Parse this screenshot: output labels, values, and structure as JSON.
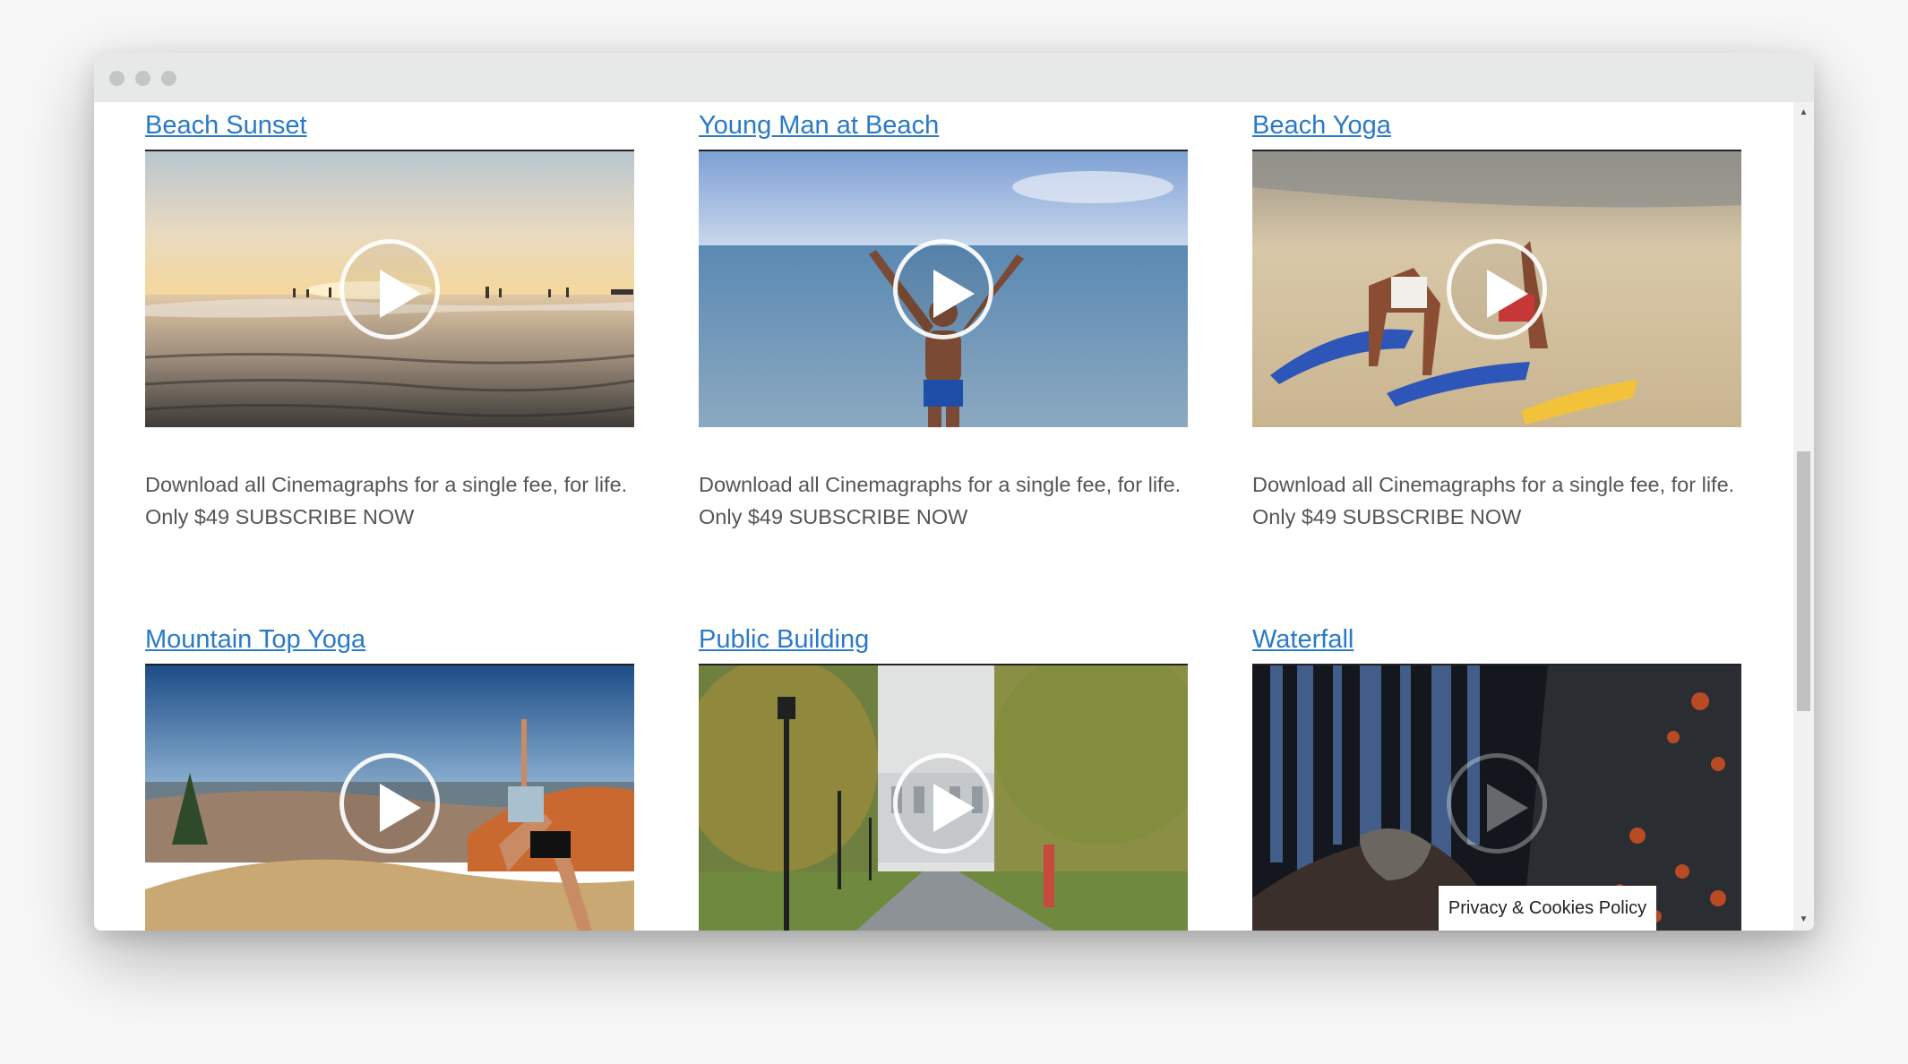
{
  "window": {
    "controls": [
      "close",
      "minimize",
      "maximize"
    ]
  },
  "cards": [
    {
      "title": "Beach Sunset",
      "description": "Download all Cinemagraphs for a single fee, for life.",
      "cta": "Only $49 SUBSCRIBE NOW",
      "thumbnail": "sunset-beach"
    },
    {
      "title": "Young Man at Beach",
      "description": "Download all Cinemagraphs for a single fee, for life.",
      "cta": "Only $49 SUBSCRIBE NOW",
      "thumbnail": "man-at-sea"
    },
    {
      "title": "Beach Yoga",
      "description": "Download all Cinemagraphs for a single fee, for life.",
      "cta": "Only $49 SUBSCRIBE NOW",
      "thumbnail": "beach-yoga"
    },
    {
      "title": "Mountain Top Yoga",
      "thumbnail": "mountain-yoga"
    },
    {
      "title": "Public Building",
      "thumbnail": "park-building"
    },
    {
      "title": "Waterfall",
      "thumbnail": "waterfall-rocks"
    }
  ],
  "cookie": {
    "label": "Privacy & Cookies Policy"
  }
}
